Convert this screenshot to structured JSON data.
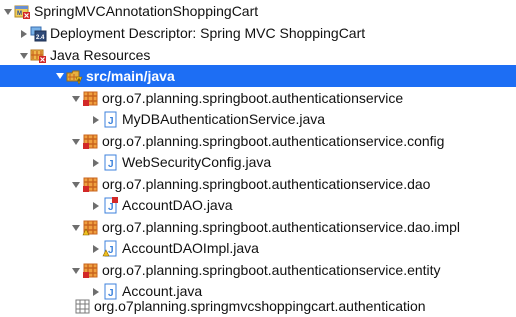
{
  "tree": {
    "project": "SpringMVCAnnotationShoppingCart",
    "deployment_descriptor": "Deployment Descriptor: Spring MVC ShoppingCart",
    "java_resources": "Java Resources",
    "source_folder": "src/main/java",
    "packages": [
      {
        "name": "org.o7.planning.springboot.authenticationservice",
        "file": "MyDBAuthenticationService.java"
      },
      {
        "name": "org.o7.planning.springboot.authenticationservice.config",
        "file": "WebSecurityConfig.java"
      },
      {
        "name": "org.o7.planning.springboot.authenticationservice.dao",
        "file": "AccountDAO.java"
      },
      {
        "name": "org.o7.planning.springboot.authenticationservice.dao.impl",
        "file": "AccountDAOImpl.java"
      },
      {
        "name": "org.o7.planning.springboot.authenticationservice.entity",
        "file": "Account.java"
      }
    ],
    "empty_package": "org.o7planning.springmvcshoppingcart.authentication"
  },
  "colors": {
    "selection": "#1d6ef4",
    "package": "#c8641e",
    "java_file": "#3c82dc",
    "error": "#d22828",
    "warning": "#f0c020"
  }
}
